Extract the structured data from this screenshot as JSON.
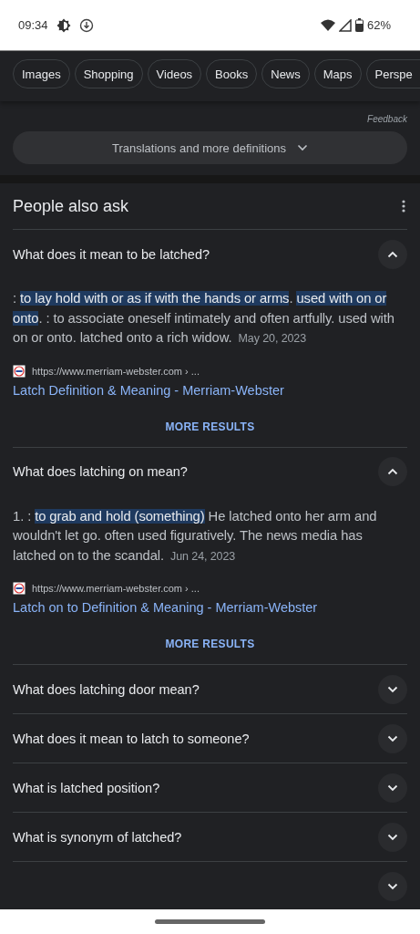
{
  "status_bar": {
    "time": "09:34",
    "battery": "62%"
  },
  "chips": [
    {
      "label": "Images"
    },
    {
      "label": "Shopping"
    },
    {
      "label": "Videos"
    },
    {
      "label": "Books"
    },
    {
      "label": "News"
    },
    {
      "label": "Maps"
    },
    {
      "label": "Perspe"
    }
  ],
  "feedback": "Feedback",
  "translations_button": "Translations and more definitions",
  "people_also_ask": {
    "title": "People also ask",
    "questions": [
      {
        "question": "What does it mean to be latched?",
        "expanded": true,
        "answer": [
          {
            "text": ": ",
            "highlighted": false
          },
          {
            "text": "to lay hold with or as if with the hands or arms",
            "highlighted": true
          },
          {
            "text": ". ",
            "highlighted": false
          },
          {
            "text": "used with on or onto",
            "highlighted": true
          },
          {
            "text": ". : to associate oneself intimately and often artfully. used with on or onto. latched onto a rich widow.",
            "highlighted": false
          }
        ],
        "date": "May 20, 2023",
        "source_url": "https://www.merriam-webster.com › ...",
        "link": "Latch Definition & Meaning - Merriam-Webster",
        "more": "MORE RESULTS"
      },
      {
        "question": "What does latching on mean?",
        "expanded": true,
        "answer": [
          {
            "text": "1. : ",
            "highlighted": false
          },
          {
            "text": "to grab and hold (something)",
            "highlighted": true
          },
          {
            "text": " He latched onto her arm and wouldn't let go. often used figuratively. The news media has latched on to the scandal.",
            "highlighted": false
          }
        ],
        "date": "Jun 24, 2023",
        "source_url": "https://www.merriam-webster.com › ...",
        "link": "Latch on to Definition & Meaning - Merriam-Webster",
        "more": "MORE RESULTS"
      },
      {
        "question": "What does latching door mean?",
        "expanded": false
      },
      {
        "question": "What does it mean to latch to someone?",
        "expanded": false
      },
      {
        "question": "What is latched position?",
        "expanded": false
      },
      {
        "question": "What is synonym of latched?",
        "expanded": false
      },
      {
        "expanded": false
      }
    ]
  }
}
